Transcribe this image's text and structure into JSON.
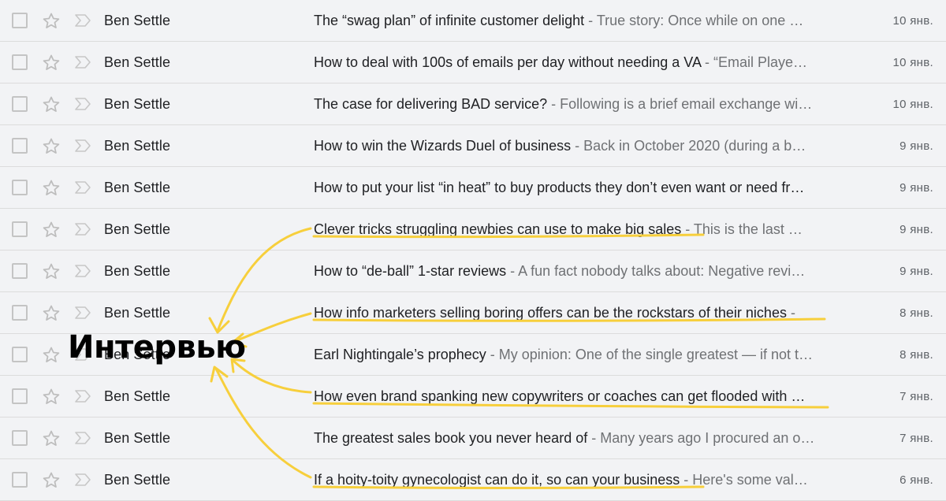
{
  "annotation": {
    "label": "Интервью",
    "color": "#f7cf3c"
  },
  "emails": [
    {
      "sender": "Ben Settle",
      "subject": "The “swag plan” of infinite customer delight",
      "snippet": " - True story: Once while on one …",
      "date": "10 янв.",
      "highlighted": false
    },
    {
      "sender": "Ben Settle",
      "subject": "How to deal with 100s of emails per day without needing a VA",
      "snippet": " - “Email Playe…",
      "date": "10 янв.",
      "highlighted": false
    },
    {
      "sender": "Ben Settle",
      "subject": "The case for delivering BAD service?",
      "snippet": " - Following is a brief email exchange wi…",
      "date": "10 янв.",
      "highlighted": false
    },
    {
      "sender": "Ben Settle",
      "subject": "How to win the Wizards Duel of business",
      "snippet": " - Back in October 2020 (during a b…",
      "date": "9 янв.",
      "highlighted": false
    },
    {
      "sender": "Ben Settle",
      "subject": "How to put your list “in heat” to buy products they don’t even want or need fr…",
      "snippet": "",
      "date": "9 янв.",
      "highlighted": false
    },
    {
      "sender": "Ben Settle",
      "subject": "Clever tricks struggling newbies can use to make big sales",
      "snippet": " - This is the last …",
      "date": "9 янв.",
      "highlighted": true
    },
    {
      "sender": "Ben Settle",
      "subject": "How to “de-ball” 1-star reviews",
      "snippet": " - A fun fact nobody talks about: Negative revi…",
      "date": "9 янв.",
      "highlighted": false
    },
    {
      "sender": "Ben Settle",
      "subject": "How info marketers selling boring offers can be the rockstars of their niches",
      "snippet": " -",
      "date": "8 янв.",
      "highlighted": true
    },
    {
      "sender": "Ben Settle",
      "subject": "Earl Nightingale’s prophecy",
      "snippet": " - My opinion: One of the single greatest — if not t…",
      "date": "8 янв.",
      "highlighted": false
    },
    {
      "sender": "Ben Settle",
      "subject": "How even brand spanking new copywriters or coaches can get flooded with …",
      "snippet": "",
      "date": "7 янв.",
      "highlighted": true
    },
    {
      "sender": "Ben Settle",
      "subject": "The greatest sales book you never heard of",
      "snippet": " - Many years ago I procured an o…",
      "date": "7 янв.",
      "highlighted": false
    },
    {
      "sender": "Ben Settle",
      "subject": "If a hoity-toity gynecologist can do it, so can your business",
      "snippet": " - Here's some val…",
      "date": "6 янв.",
      "highlighted": true
    }
  ]
}
